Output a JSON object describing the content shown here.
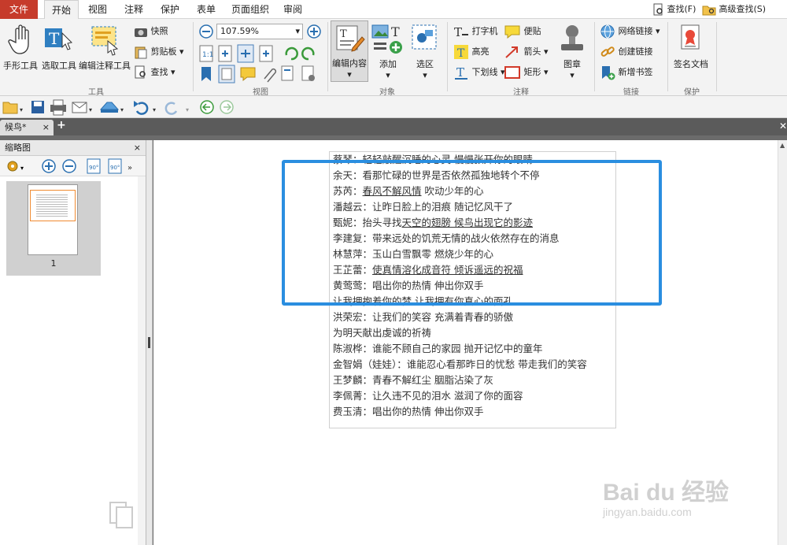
{
  "menubar": {
    "file": "文件",
    "tabs": [
      "开始",
      "视图",
      "注释",
      "保护",
      "表单",
      "页面组织",
      "审阅"
    ],
    "find": "查找(F)",
    "advanced_find": "高级查找(S)"
  },
  "ribbon": {
    "tools_group": "工具",
    "hand_tool": "手形工具",
    "select_tool": "选取工具",
    "annot_select_tool": "编辑注释工具",
    "snapshot": "快照",
    "clipboard": "剪贴板",
    "find": "查找",
    "view_group": "视图",
    "zoom_value": "107.59%",
    "object_group": "对象",
    "edit_content": "编辑内容",
    "add": "添加",
    "select_area": "选区",
    "annot_group": "注释",
    "typewriter": "打字机",
    "note": "便贴",
    "highlight": "高亮",
    "arrow": "箭头",
    "underline": "下划线",
    "rectangle": "矩形",
    "stamp": "图章",
    "link_group": "链接",
    "web_link": "网络链接",
    "create_link": "创建链接",
    "add_bookmark": "新增书签",
    "protect_group": "保护",
    "sign_doc": "签名文档"
  },
  "doc_tab": {
    "name": "候鸟",
    "modified": "*",
    "close": "×",
    "new": "+"
  },
  "panel": {
    "title": "缩略图",
    "close": "×",
    "page_number": "1"
  },
  "page_lines": [
    "蔡琴：轻轻敲醒沉睡的心灵 慢慢张开你的眼睛",
    "余天：看那忙碌的世界是否依然孤独地转个不停",
    "苏芮：春风不解风情 吹动少年的心",
    "潘越云：让昨日脸上的泪痕 随记忆风干了",
    "甄妮：抬头寻找天空的翅膀 候鸟出现它的影迹",
    "李建复：带来远处的饥荒无情的战火依然存在的消息",
    "林慧萍：玉山白雪飘零 燃烧少年的心",
    "王芷蕾：使真情溶化成音符 倾诉遥远的祝福",
    "黄莺莺：唱出你的热情 伸出你双手",
    "让我拥抱着你的梦 让我拥有你真心的面孔",
    "洪荣宏：让我们的笑容 充满着青春的骄傲",
    "为明天献出虔诚的祈祷",
    "陈淑桦：谁能不顾自己的家园 抛开记忆中的童年",
    "金智娟（娃娃）：谁能忍心看那昨日的忧愁 带走我们的笑容",
    "王梦麟：青春不解红尘 胭脂沾染了灰",
    "李佩菁：让久违不见的泪水 滋润了你的面容",
    "费玉清：唱出你的热情 伸出你双手"
  ],
  "watermark": {
    "brand": "Bai du 经验",
    "url": "jingyan.baidu.com"
  },
  "colors": {
    "accent_file": "#c63b2b",
    "highlight_box": "#2a8ee0"
  }
}
